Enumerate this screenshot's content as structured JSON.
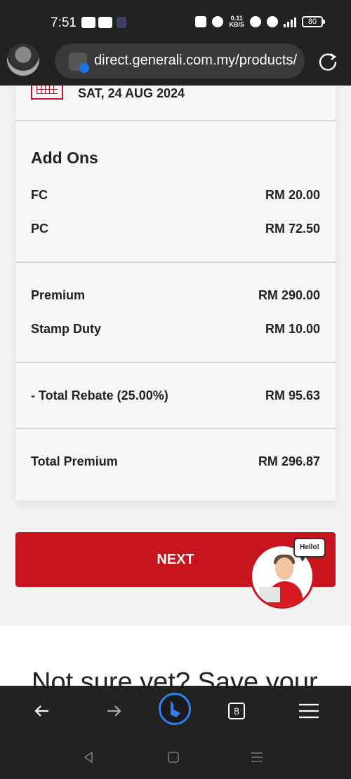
{
  "status_bar": {
    "time": "7:51",
    "net_speed_value": "0.11",
    "net_speed_unit": "KB/S",
    "battery": "80"
  },
  "browser": {
    "url": "direct.generali.com.my/products/",
    "tab_count": "8"
  },
  "summary": {
    "date": "SAT, 24 AUG 2024",
    "add_ons_title": "Add Ons",
    "add_ons": [
      {
        "label": "FC",
        "value": "RM 20.00"
      },
      {
        "label": "PC",
        "value": "RM 72.50"
      }
    ],
    "premium": {
      "label": "Premium",
      "value": "RM 290.00"
    },
    "stamp_duty": {
      "label": "Stamp Duty",
      "value": "RM 10.00"
    },
    "rebate": {
      "label": "- Total Rebate (25.00%)",
      "value": "RM 95.63"
    },
    "total": {
      "label": "Total Premium",
      "value": "RM 296.87"
    }
  },
  "actions": {
    "next_label": "NEXT"
  },
  "chat_agent": {
    "greeting": "Hello!"
  },
  "promo": {
    "text": "Not sure yet? Save your"
  },
  "colors": {
    "brand_red": "#c8141c",
    "dark_bar": "#222222",
    "bing_blue": "#2f80ed"
  }
}
